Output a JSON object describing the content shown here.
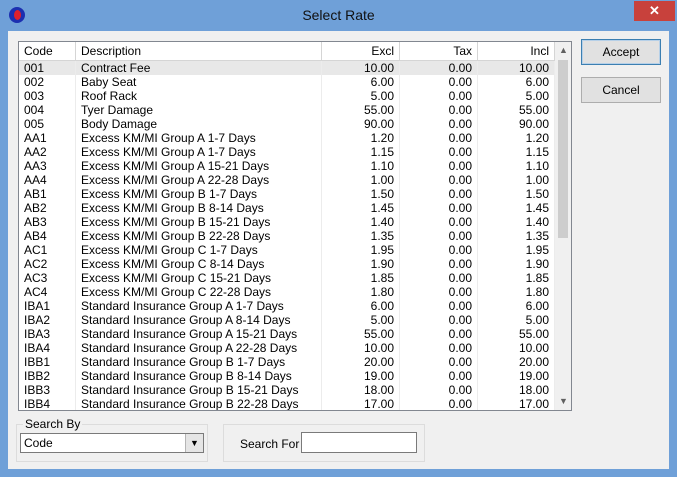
{
  "window": {
    "title": "Select Rate",
    "close_glyph": "✕"
  },
  "columns": {
    "code": "Code",
    "description": "Description",
    "excl": "Excl",
    "tax": "Tax",
    "incl": "Incl"
  },
  "rows": [
    {
      "code": "001",
      "description": "Contract Fee",
      "excl": "10.00",
      "tax": "0.00",
      "incl": "10.00"
    },
    {
      "code": "002",
      "description": "Baby Seat",
      "excl": "6.00",
      "tax": "0.00",
      "incl": "6.00"
    },
    {
      "code": "003",
      "description": "Roof Rack",
      "excl": "5.00",
      "tax": "0.00",
      "incl": "5.00"
    },
    {
      "code": "004",
      "description": "Tyer Damage",
      "excl": "55.00",
      "tax": "0.00",
      "incl": "55.00"
    },
    {
      "code": "005",
      "description": "Body Damage",
      "excl": "90.00",
      "tax": "0.00",
      "incl": "90.00"
    },
    {
      "code": "AA1",
      "description": "Excess KM/MI Group A 1-7 Days",
      "excl": "1.20",
      "tax": "0.00",
      "incl": "1.20"
    },
    {
      "code": "AA2",
      "description": "Excess KM/MI Group A 1-7 Days",
      "excl": "1.15",
      "tax": "0.00",
      "incl": "1.15"
    },
    {
      "code": "AA3",
      "description": "Excess KM/MI Group A 15-21 Days",
      "excl": "1.10",
      "tax": "0.00",
      "incl": "1.10"
    },
    {
      "code": "AA4",
      "description": "Excess KM/MI Group A 22-28 Days",
      "excl": "1.00",
      "tax": "0.00",
      "incl": "1.00"
    },
    {
      "code": "AB1",
      "description": "Excess KM/MI Group B 1-7 Days",
      "excl": "1.50",
      "tax": "0.00",
      "incl": "1.50"
    },
    {
      "code": "AB2",
      "description": "Excess KM/MI Group B 8-14 Days",
      "excl": "1.45",
      "tax": "0.00",
      "incl": "1.45"
    },
    {
      "code": "AB3",
      "description": "Excess KM/MI Group B 15-21 Days",
      "excl": "1.40",
      "tax": "0.00",
      "incl": "1.40"
    },
    {
      "code": "AB4",
      "description": "Excess KM/MI Group B 22-28 Days",
      "excl": "1.35",
      "tax": "0.00",
      "incl": "1.35"
    },
    {
      "code": "AC1",
      "description": "Excess KM/MI Group C 1-7 Days",
      "excl": "1.95",
      "tax": "0.00",
      "incl": "1.95"
    },
    {
      "code": "AC2",
      "description": "Excess KM/MI Group C 8-14 Days",
      "excl": "1.90",
      "tax": "0.00",
      "incl": "1.90"
    },
    {
      "code": "AC3",
      "description": "Excess KM/MI Group C 15-21 Days",
      "excl": "1.85",
      "tax": "0.00",
      "incl": "1.85"
    },
    {
      "code": "AC4",
      "description": "Excess KM/MI Group C 22-28 Days",
      "excl": "1.80",
      "tax": "0.00",
      "incl": "1.80"
    },
    {
      "code": "IBA1",
      "description": "Standard Insurance Group A 1-7 Days",
      "excl": "6.00",
      "tax": "0.00",
      "incl": "6.00"
    },
    {
      "code": "IBA2",
      "description": "Standard Insurance Group A 8-14 Days",
      "excl": "5.00",
      "tax": "0.00",
      "incl": "5.00"
    },
    {
      "code": "IBA3",
      "description": "Standard Insurance Group A 15-21 Days",
      "excl": "55.00",
      "tax": "0.00",
      "incl": "55.00"
    },
    {
      "code": "IBA4",
      "description": "Standard Insurance Group A 22-28 Days",
      "excl": "10.00",
      "tax": "0.00",
      "incl": "10.00"
    },
    {
      "code": "IBB1",
      "description": "Standard Insurance Group B 1-7 Days",
      "excl": "20.00",
      "tax": "0.00",
      "incl": "20.00"
    },
    {
      "code": "IBB2",
      "description": "Standard Insurance Group B 8-14 Days",
      "excl": "19.00",
      "tax": "0.00",
      "incl": "19.00"
    },
    {
      "code": "IBB3",
      "description": "Standard Insurance Group B 15-21 Days",
      "excl": "18.00",
      "tax": "0.00",
      "incl": "18.00"
    },
    {
      "code": "IBB4",
      "description": "Standard Insurance Group B 22-28 Days",
      "excl": "17.00",
      "tax": "0.00",
      "incl": "17.00"
    }
  ],
  "buttons": {
    "accept": "Accept",
    "cancel": "Cancel"
  },
  "search_by": {
    "legend": "Search By",
    "selected": "Code"
  },
  "search_for": {
    "label": "Search For",
    "value": ""
  },
  "icons": {
    "scroll_up": "▲",
    "scroll_down": "▼",
    "dropdown": "▼"
  }
}
